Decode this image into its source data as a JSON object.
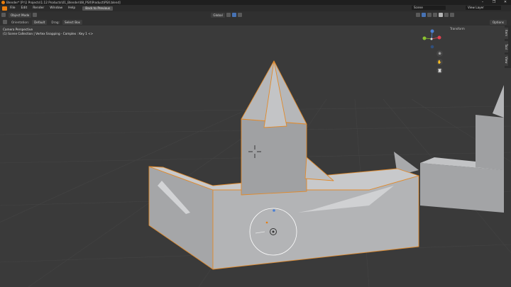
{
  "window": {
    "title": "Blender* [P:\\1 Projects\\1.12 Products\\01_Blender\\08_PSX\\Product\\PSX.blend]",
    "controls": [
      "–",
      "❐",
      "✕"
    ]
  },
  "menu": {
    "items": [
      "File",
      "Edit",
      "Render",
      "Window",
      "Help"
    ],
    "back_label": "Back to Previous",
    "scene_label": "Scene",
    "view_layer_label": "View Layer"
  },
  "header": {
    "mode_label": "Object Mode",
    "transform_label": "Global",
    "orientation_label": "Orientation:",
    "orientation_value": "Default",
    "drag_label": "Drag:",
    "drag_value": "Select Box",
    "options_label": "Options"
  },
  "viewport": {
    "view_name": "Camera Perspective",
    "context": "(1) Scene Collection | Vertex Snapping - Complex : Key 1 <>"
  },
  "npanel": {
    "transform_label": "Transform",
    "tabs": [
      "Item",
      "Tool",
      "View"
    ]
  },
  "colors": {
    "accent": "#e87d0d",
    "viewport_bg": "#3a3a3a",
    "mesh": "#a9aaac"
  }
}
